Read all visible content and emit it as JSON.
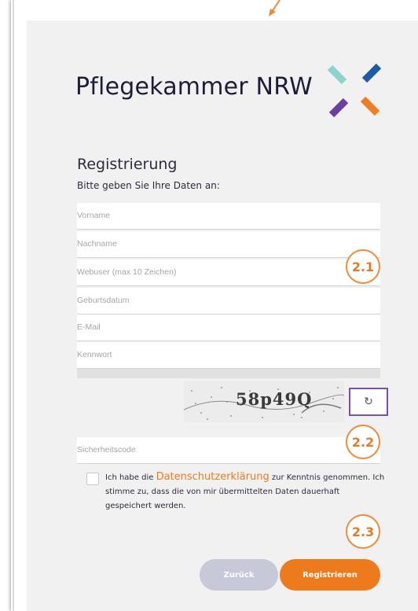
{
  "logo": {
    "text": "Pflegekammer NRW",
    "colors": [
      "#8fd3cf",
      "#1e5aa8",
      "#6a3fa0",
      "#ef7d22"
    ]
  },
  "form": {
    "title": "Registrierung",
    "subtitle": "Bitte geben Sie Ihre Daten an:",
    "fields": [
      {
        "placeholder": "Vorname"
      },
      {
        "placeholder": "Nachname"
      },
      {
        "placeholder": "Webuser (max 10 Zeichen)"
      },
      {
        "placeholder": "Geburtsdatum"
      },
      {
        "placeholder": "E-Mail"
      },
      {
        "placeholder": "Kennwort"
      }
    ],
    "captcha": {
      "text": "58p49Q",
      "refresh_icon": "refresh-icon"
    },
    "security_code_placeholder": "Sicherheitscode",
    "consent": {
      "prefix": "Ich habe die ",
      "link": "Datenschutzerklärung",
      "suffix": " zur Kenntnis genommen. Ich stimme zu, dass die von mir übermittelten Daten dauerhaft gespeichert werden."
    },
    "buttons": {
      "back": "Zurück",
      "register": "Registrieren"
    }
  },
  "annotations": [
    "2.1",
    "2.2",
    "2.3"
  ],
  "accent_color": "#ee7a1e"
}
